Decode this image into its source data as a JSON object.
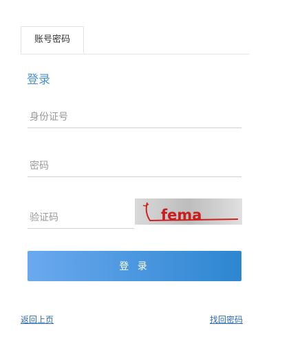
{
  "tabs": [
    {
      "label": "账号密码"
    }
  ],
  "heading": "登录",
  "fields": {
    "id_number": {
      "placeholder": "身份证号",
      "value": ""
    },
    "password": {
      "placeholder": "密码",
      "value": ""
    },
    "captcha": {
      "placeholder": "验证码",
      "value": ""
    }
  },
  "captcha_text": "fema",
  "login_button": "登 录",
  "links": {
    "back": "返回上页",
    "find_password": "找回密码"
  },
  "colors": {
    "accent": "#4a90d9",
    "button_start": "#6aa9ef",
    "button_end": "#2d86d0",
    "link": "#2a6ab8"
  }
}
